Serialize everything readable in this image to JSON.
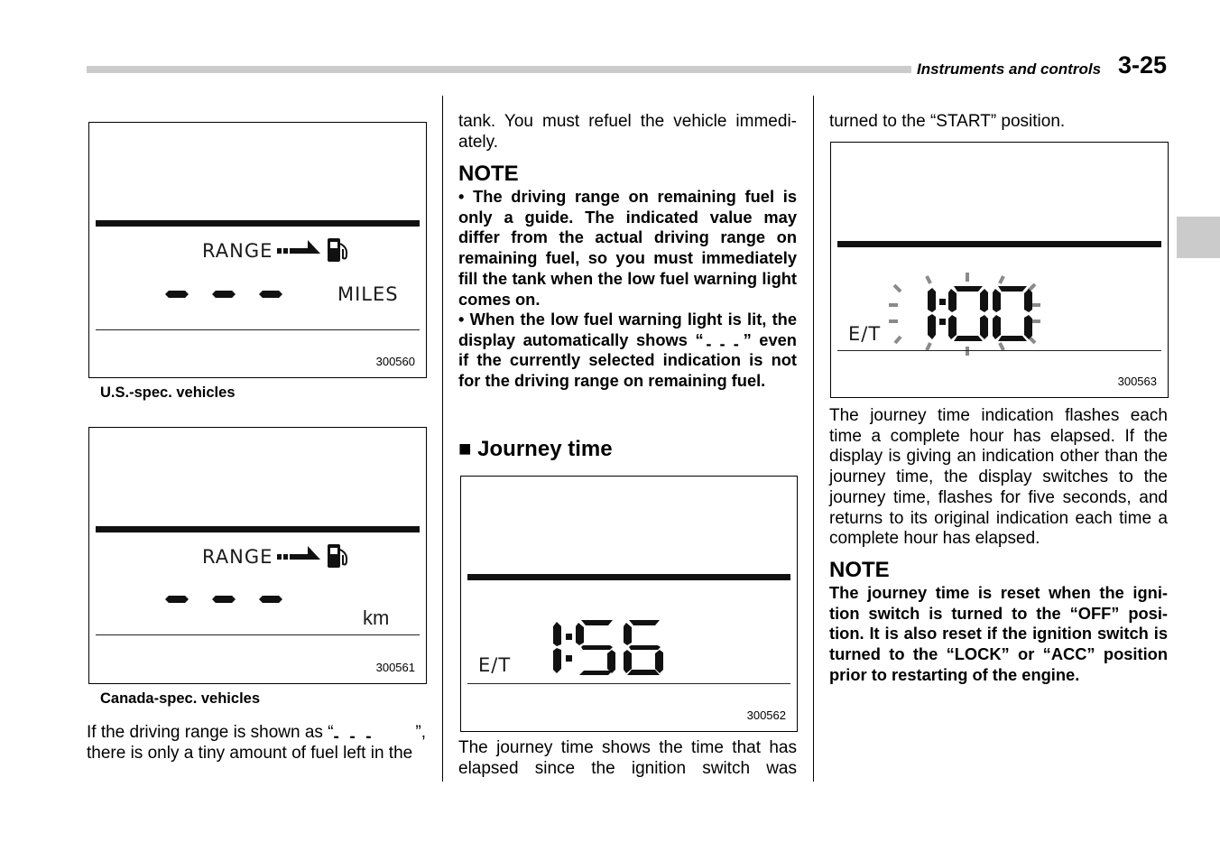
{
  "header": {
    "section_title": "Instruments and controls",
    "page_number": "3-25"
  },
  "figures": [
    {
      "id": "us",
      "label": "RANGE",
      "unit": "MILES",
      "dashes": "- - -",
      "figure_number": "300560",
      "caption": "U.S.-spec. vehicles",
      "icons": [
        "arrow-icon",
        "fuel-pump-icon"
      ]
    },
    {
      "id": "canada",
      "label": "RANGE",
      "unit": "km",
      "dashes": "- - -",
      "figure_number": "300561",
      "caption": "Canada-spec. vehicles",
      "icons": [
        "arrow-icon",
        "fuel-pump-icon"
      ]
    },
    {
      "id": "journey",
      "label": "E/T",
      "time": "1:56",
      "figure_number": "300562"
    },
    {
      "id": "journey-flash",
      "label": "E/T",
      "time": "1:00",
      "flashing": true,
      "figure_number": "300563"
    }
  ],
  "col1": {
    "para_start": "If the driving range is shown as “",
    "para_dashes": "- - -",
    "para_mid": "”,",
    "para_end": "there is only a tiny amount of fuel left in the"
  },
  "col2": {
    "para_cont": "tank. You must refuel the vehicle immedi-ately.",
    "note_heading": "NOTE",
    "note_bullet1": "• The driving range on remaining fuel is only a guide. The indicated value may differ from the actual driving range on remaining fuel, so you must immediately fill the tank when the low fuel warning light comes on.",
    "note_bullet2_a": "• When the low fuel warning light is lit, the display automatically shows",
    "note_bullet2_q1": "“",
    "note_bullet2_dashes": "- - -",
    "note_bullet2_b": "” even if the currently selected indication is not for the driving range on remaining fuel.",
    "section_heading": "Journey time",
    "section_marker": "■",
    "para_journey": "The journey time shows the time that has elapsed since the ignition switch was"
  },
  "col3": {
    "para_cont": "turned to the “START” position.",
    "para_flash": "The journey time indication flashes each time a complete hour has elapsed. If the display is giving an indication other than the journey time, the display switches to the journey time, flashes for five seconds, and returns to its original indication each time a complete hour has elapsed.",
    "note_heading": "NOTE",
    "note_text": "The journey time is reset when the igni-tion switch is turned to the “OFF” posi-tion. It is also reset if the ignition switch is turned to the “LOCK” or “ACC” position prior to restarting of the engine."
  }
}
